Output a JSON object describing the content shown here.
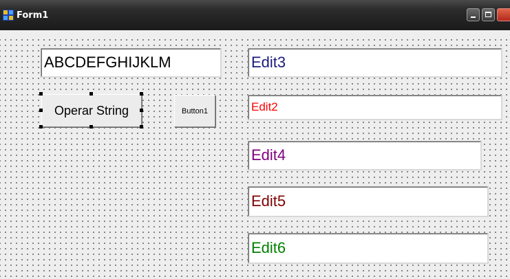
{
  "window": {
    "title": "Form1",
    "app_icon": "cpp-builder-icon",
    "controls": [
      "minimize",
      "maximize",
      "close"
    ]
  },
  "edits": {
    "edit1": {
      "value": "ABCDEFGHIJKLM",
      "color": "#000000"
    },
    "edit3": {
      "value": "Edit3",
      "color": "#1a1a80"
    },
    "edit2": {
      "value": "Edit2",
      "color": "#ff0000"
    },
    "edit4": {
      "value": "Edit4",
      "color": "#800080"
    },
    "edit5": {
      "value": "Edit5",
      "color": "#800000"
    },
    "edit6": {
      "value": "Edit6",
      "color": "#008000"
    }
  },
  "buttons": {
    "operar": {
      "label": "Operar String",
      "selected": true
    },
    "button1": {
      "label": "Button1"
    }
  }
}
